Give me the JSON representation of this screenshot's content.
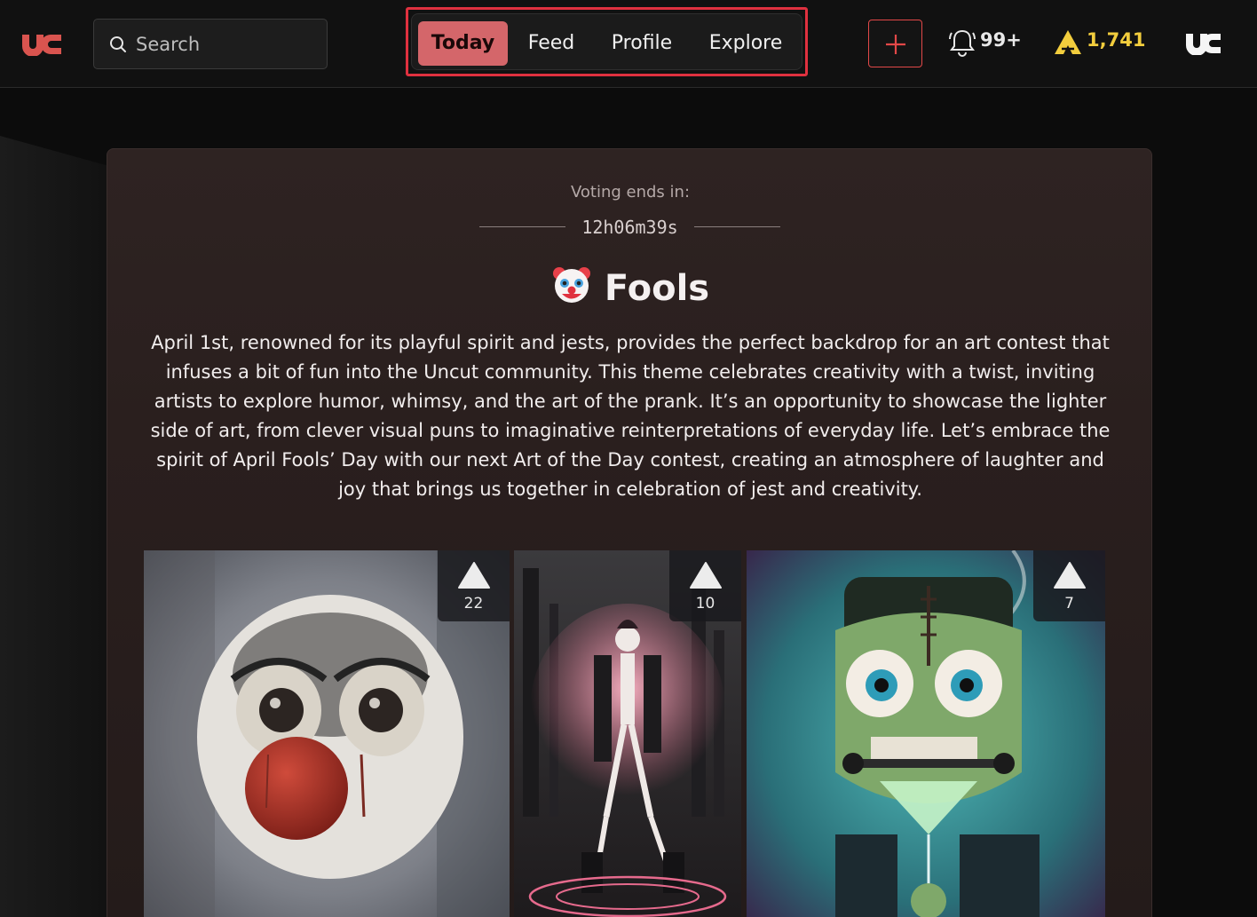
{
  "header": {
    "search_placeholder": "Search",
    "tabs": [
      {
        "label": "Today",
        "active": true
      },
      {
        "label": "Feed",
        "active": false
      },
      {
        "label": "Profile",
        "active": false
      },
      {
        "label": "Explore",
        "active": false
      }
    ],
    "notifications": "99+",
    "points": "1,741",
    "colors": {
      "accent": "#d4666a",
      "highlight": "#e0313f",
      "points": "#f2cd3d",
      "brand": "#d9544f"
    }
  },
  "contest": {
    "voting_label": "Voting ends in:",
    "timer": "12h06m39s",
    "title": "Fools",
    "title_icon": "clown-face-icon",
    "description": "April 1st, renowned for its playful spirit and jests, provides the perfect backdrop for an art contest that infuses a bit of fun into the Uncut community. This theme celebrates creativity with a twist, inviting artists to explore humor, whimsy, and the art of the prank. It’s an opportunity to showcase the lighter side of art, from clever visual puns to imaginative reinterpretations of everyday life. Let’s embrace the spirit of April Fools’ Day with our next Art of the Day contest, creating an atmosphere of laughter and joy that brings us together in celebration of jest and creativity."
  },
  "entries": [
    {
      "subject": "clown-painting",
      "votes": "22"
    },
    {
      "subject": "skeleton-dancer",
      "votes": "10"
    },
    {
      "subject": "frankenstein-martini",
      "votes": "7"
    }
  ]
}
